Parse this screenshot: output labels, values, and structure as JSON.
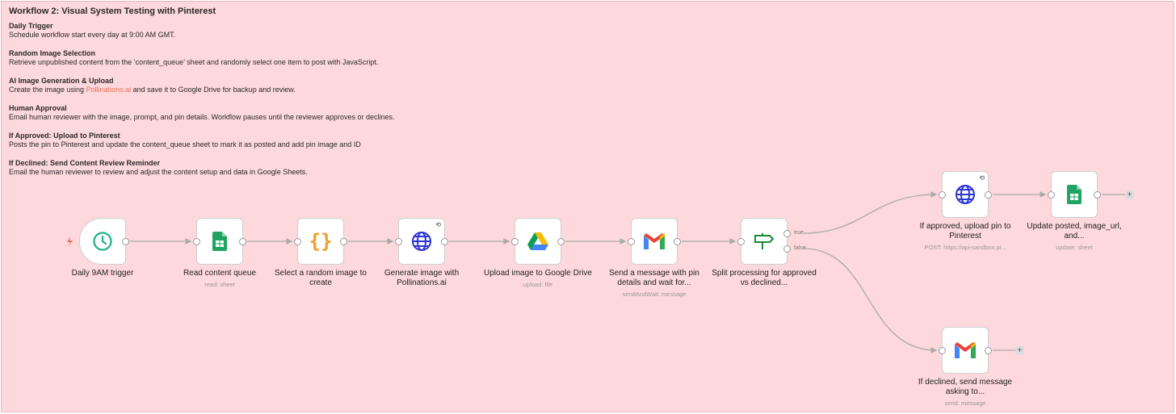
{
  "note": {
    "title": "Workflow 2: Visual System Testing with Pinterest",
    "sections": [
      {
        "heading": "Daily Trigger",
        "text": "Schedule workflow start every day at 9:00 AM GMT."
      },
      {
        "heading": "Random Image Selection",
        "text": "Retrieve unpublished content from the ‘content_queue’ sheet and randomly select one item to post with JavaScript."
      },
      {
        "heading": "AI Image Generation & Upload",
        "text_before": "Create the image using ",
        "link": "Pollinations.ai",
        "text_after": " and save it to Google Drive for backup and review."
      },
      {
        "heading": "Human Approval",
        "text": "Email human reviewer with the image, prompt, and pin details. Workflow pauses until the reviewer approves or declines."
      },
      {
        "heading": "If Approved: Upload to Pinterest",
        "text": "Posts the pin to Pinterest and update the content_queue sheet to mark it as posted and add pin image and ID"
      },
      {
        "heading": "If Declined: Send Content Review Reminder",
        "text": "Email the human reviewer to review and adjust the content setup and data in Google Sheets."
      }
    ]
  },
  "nodes": {
    "trigger": {
      "label": "Daily 9AM trigger",
      "icon": "clock-icon"
    },
    "read": {
      "label": "Read content queue",
      "sub": "read: sheet",
      "icon": "google-sheets-icon"
    },
    "code": {
      "label": "Select a random image to create",
      "icon": "code-braces-icon"
    },
    "generate": {
      "label": "Generate image with Pollinations.ai",
      "icon": "globe-icon"
    },
    "drive": {
      "label": "Upload image to Google Drive",
      "sub": "upload: file",
      "icon": "google-drive-icon"
    },
    "gmail": {
      "label": "Send a message with pin details and wait for...",
      "sub": "sendAndWait: message",
      "icon": "gmail-icon"
    },
    "if": {
      "label": "Split processing for approved vs declined...",
      "icon": "signpost-icon",
      "true_label": "true",
      "false_label": "false"
    },
    "approved": {
      "label": "If approved, upload pin to Pinterest",
      "sub": "POST: https://api-sandbox.pi...",
      "icon": "globe-icon"
    },
    "update": {
      "label": "Update posted, image_url, and...",
      "sub": "update: sheet",
      "icon": "google-sheets-icon"
    },
    "declined": {
      "label": "If declined, send message asking to...",
      "sub": "send: message",
      "icon": "gmail-icon"
    }
  },
  "plus": "+",
  "colors": {
    "canvas": "#fdd8dc",
    "link": "#ef6f58"
  }
}
